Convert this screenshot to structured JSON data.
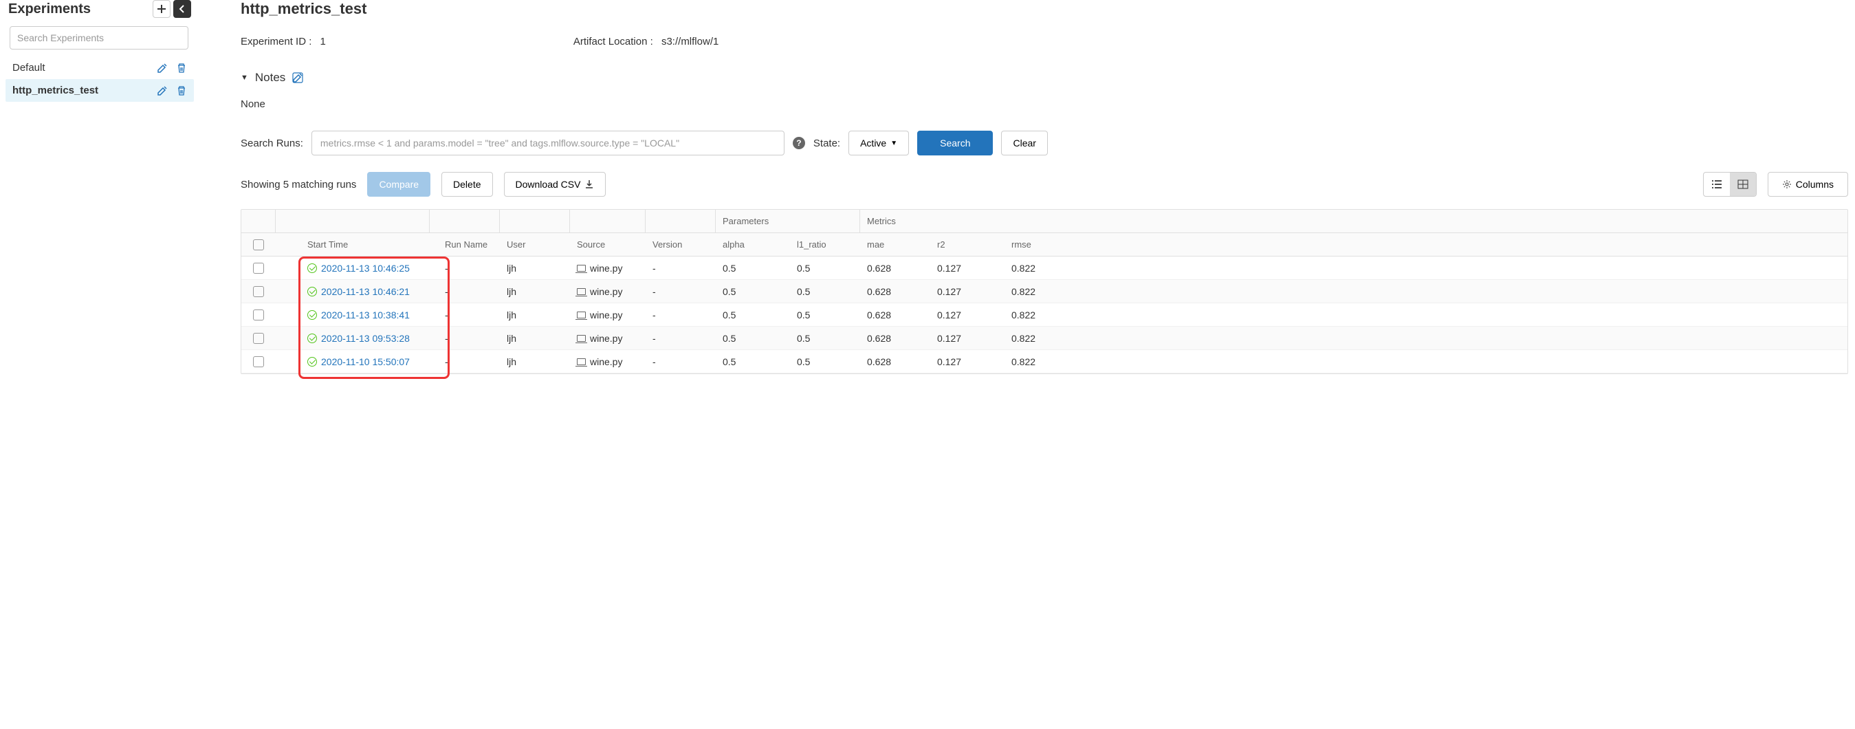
{
  "sidebar": {
    "title": "Experiments",
    "search_placeholder": "Search Experiments",
    "items": [
      {
        "name": "Default",
        "active": false
      },
      {
        "name": "http_metrics_test",
        "active": true
      }
    ]
  },
  "main": {
    "title": "http_metrics_test",
    "experiment_id_label": "Experiment ID :",
    "experiment_id": "1",
    "artifact_label": "Artifact Location :",
    "artifact_location": "s3://mlflow/1",
    "notes_label": "Notes",
    "notes_value": "None"
  },
  "search_runs": {
    "label": "Search Runs:",
    "placeholder": "metrics.rmse < 1 and params.model = \"tree\" and tags.mlflow.source.type = \"LOCAL\"",
    "state_label": "State:",
    "active_label": "Active",
    "search_btn": "Search",
    "clear_btn": "Clear"
  },
  "toolbar": {
    "matching": "Showing 5 matching runs",
    "compare": "Compare",
    "delete": "Delete",
    "download": "Download CSV",
    "columns": "Columns"
  },
  "table": {
    "group_params": "Parameters",
    "group_metrics": "Metrics",
    "headers": {
      "start_time": "Start Time",
      "run_name": "Run Name",
      "user": "User",
      "source": "Source",
      "version": "Version",
      "alpha": "alpha",
      "l1_ratio": "l1_ratio",
      "mae": "mae",
      "r2": "r2",
      "rmse": "rmse"
    },
    "rows": [
      {
        "start": "2020-11-13 10:46:25",
        "run_name": "-",
        "user": "ljh",
        "source": "wine.py",
        "version": "-",
        "alpha": "0.5",
        "l1_ratio": "0.5",
        "mae": "0.628",
        "r2": "0.127",
        "rmse": "0.822"
      },
      {
        "start": "2020-11-13 10:46:21",
        "run_name": "-",
        "user": "ljh",
        "source": "wine.py",
        "version": "-",
        "alpha": "0.5",
        "l1_ratio": "0.5",
        "mae": "0.628",
        "r2": "0.127",
        "rmse": "0.822"
      },
      {
        "start": "2020-11-13 10:38:41",
        "run_name": "-",
        "user": "ljh",
        "source": "wine.py",
        "version": "-",
        "alpha": "0.5",
        "l1_ratio": "0.5",
        "mae": "0.628",
        "r2": "0.127",
        "rmse": "0.822"
      },
      {
        "start": "2020-11-13 09:53:28",
        "run_name": "-",
        "user": "ljh",
        "source": "wine.py",
        "version": "-",
        "alpha": "0.5",
        "l1_ratio": "0.5",
        "mae": "0.628",
        "r2": "0.127",
        "rmse": "0.822"
      },
      {
        "start": "2020-11-10 15:50:07",
        "run_name": "-",
        "user": "ljh",
        "source": "wine.py",
        "version": "-",
        "alpha": "0.5",
        "l1_ratio": "0.5",
        "mae": "0.628",
        "r2": "0.127",
        "rmse": "0.822"
      }
    ]
  }
}
